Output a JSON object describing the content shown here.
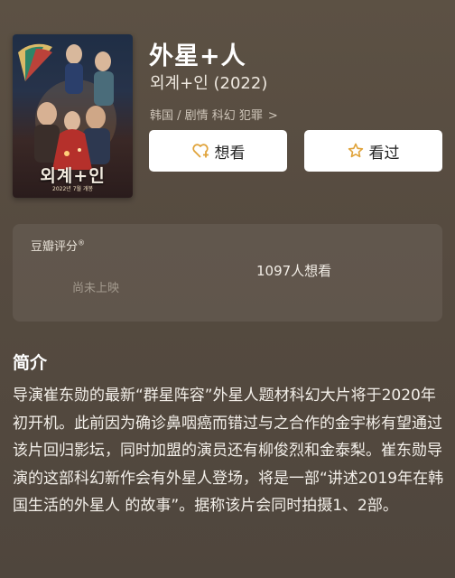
{
  "movie": {
    "title": "外星+人",
    "original_title": "외계+인 (2022)",
    "meta": "韩国 / 剧情 科幻 犯罪",
    "meta_chevron": ">"
  },
  "poster": {
    "title_text": "외계+인",
    "date_text": "2022년 7월 개봉"
  },
  "actions": {
    "want_label": "想看",
    "seen_label": "看过"
  },
  "rating": {
    "label": "豆瓣评分",
    "registered_mark": "®",
    "no_rating_text": "尚未上映",
    "want_count_text": "1097人想看"
  },
  "intro": {
    "heading": "简介",
    "text": "导演崔东勋的最新“群星阵容”外星人题材科幻大片将于2020年初开机。此前因为确诊鼻咽癌而错过与之合作的金宇彬有望通过该片回归影坛，同时加盟的演员还有柳俊烈和金泰梨。崔东勋导演的这部科幻新作会有外星人登场，将是一部“讲述2019年在韩国生活的外星人 的故事”。据称该片会同时拍摄1、2部。"
  },
  "colors": {
    "background": "#564b40",
    "card": "#625749",
    "button_bg": "#ffffff",
    "icon_accent": "#e0a33a"
  },
  "icons": {
    "want": "heart-plus-icon",
    "seen": "star-icon",
    "meta_chevron": "chevron-right-icon"
  }
}
